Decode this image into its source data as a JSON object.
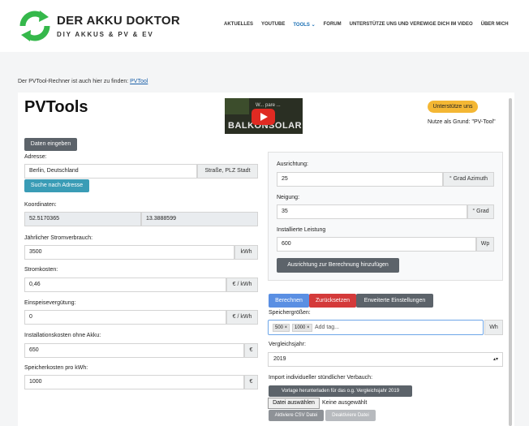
{
  "header": {
    "logo_title": "DER AKKU DOKTOR",
    "logo_subtitle": "DIY AKKUS & PV & EV",
    "nav": {
      "aktuelles": "AKTUELLES",
      "youtube": "YOUTUBE",
      "tools": "TOOLS ⌄",
      "forum": "FORUM",
      "support": "UNTERSTÜTZE UNS UND VEREWIGE DICH IM VIDEO",
      "ueber": "ÜBER MICH"
    }
  },
  "intro": {
    "text": "Der PVTool-Rechner ist auch hier zu finden: ",
    "link": "PVTool"
  },
  "page": {
    "title": "PVTools",
    "support_button": "Unterstütze uns",
    "support_reason": "Nutze als Grund: \"PV-Tool\""
  },
  "video": {
    "caption": "W...  pare ...",
    "banner": "BALKONSOLAR"
  },
  "left": {
    "daten_button": "Daten eingeben",
    "adresse_label": "Adresse:",
    "adresse_value": "Berlin, Deutschland",
    "adresse_addon": "Straße, PLZ Stadt",
    "suche_button": "Suche nach Adresse",
    "koordinaten_label": "Koordinaten:",
    "lat": "52.5170365",
    "lon": "13.3888599",
    "strom_label": "Jährlicher Stromverbrauch:",
    "strom_value": "3500",
    "strom_unit": "kWh",
    "kosten_label": "Stromkosten:",
    "kosten_value": "0,46",
    "kosten_unit": "€ / kWh",
    "einspeise_label": "Einspeisevergütung:",
    "einspeise_value": "0",
    "einspeise_unit": "€ / kWh",
    "install_label": "Installationskosten ohne Akku:",
    "install_value": "650",
    "install_unit": "€",
    "speicher_label": "Speicherkosten pro kWh:",
    "speicher_value": "1000",
    "speicher_unit": "€"
  },
  "panel": {
    "ausrichtung_label": "Ausrichtung:",
    "ausrichtung_value": "25",
    "ausrichtung_unit": "° Grad Azimuth",
    "neigung_label": "Neigung:",
    "neigung_value": "35",
    "neigung_unit": "° Grad",
    "leistung_label": "Installierte Leistung",
    "leistung_value": "600",
    "leistung_unit": "Wp",
    "add_button": "Ausrichtung zur Berechnung hinzufügen"
  },
  "actions": {
    "berechnen": "Berechnen",
    "zuruecksetzen": "Zurücksetzen",
    "erweitert": "Erweiterte Einstellungen"
  },
  "speicher": {
    "label": "Speichergrößen:",
    "tags": [
      "500 ×",
      "1000 ×"
    ],
    "placeholder": "Add tag...",
    "unit": "Wh"
  },
  "vergleich": {
    "label": "Vergleichsjahr:",
    "value": "2019"
  },
  "import": {
    "label": "Import individueller stündlicher Verbauch:",
    "template_button": "Vorlage herunterladen für das o.g. Vergleichsjahr 2019",
    "file_button": "Datei auswählen",
    "file_status": "Keine ausgewählt",
    "activate_button": "Aktiviere CSV Datei",
    "deactivate_button": "Deaktiviere Datei"
  },
  "colors": {
    "accent": "#1a6fb4",
    "support_yellow": "#f4b734",
    "berechnen_blue": "#5a8fe3",
    "reset_red": "#d43a3a",
    "dark_button": "#5c636a",
    "teal_button": "#3a9cb6",
    "logo_green": "#35b84b"
  }
}
